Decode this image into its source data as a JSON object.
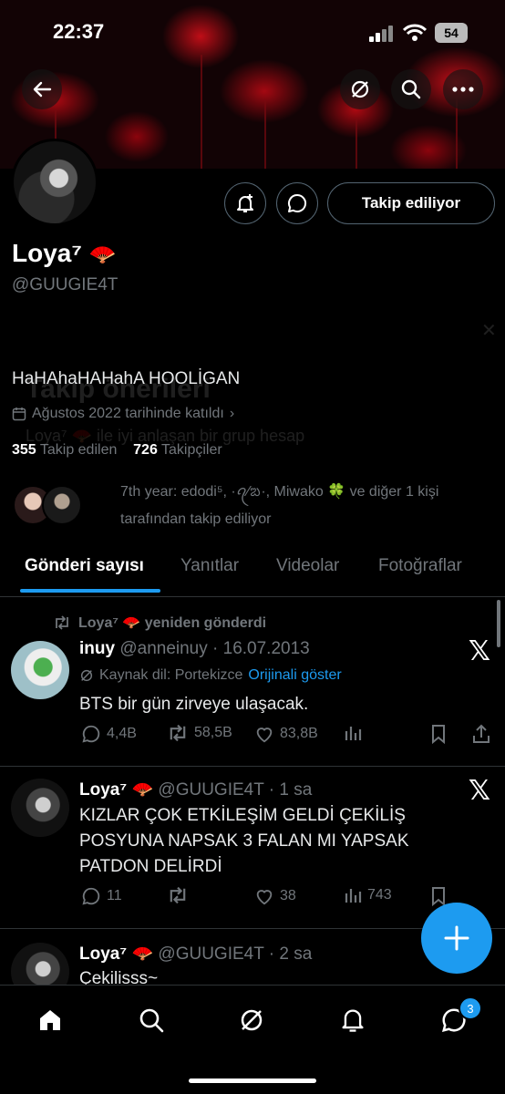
{
  "status_bar": {
    "time": "22:37",
    "battery": "54"
  },
  "profile": {
    "name": "Loya⁷",
    "handle": "@GUUGIE4T",
    "bio": "HaHAhaHAHahA HOOLİGAN",
    "joined": "Ağustos 2022 tarihinde katıldı",
    "following_count": "355",
    "following_label": "Takip edilen",
    "followers_count": "726",
    "followers_label": "Takipçiler",
    "follow_button": "Takip ediliyor",
    "followed_by": "7th year: edodi⁵, ·ꪖ⁄ᨰ·, Miwako 🍀 ve diğer 1 kişi tarafından takip ediliyor"
  },
  "ghost": {
    "title": "Takip önerileri",
    "subtitle": "Loya⁷ 🪭 ile iyi anlaşan bir grup hesap"
  },
  "tabs": [
    "Gönderi sayısı",
    "Yanıtlar",
    "Videolar",
    "Fotoğraflar"
  ],
  "posts": [
    {
      "repost_line": "Loya⁷ 🪭 yeniden gönderdi",
      "author": "inuy",
      "handle_date": "@anneinuy · 16.07.2013",
      "translate_source": "Kaynak dil: Portekizce",
      "translate_link": "Orijinali göster",
      "text": "BTS bir gün zirveye ulaşacak.",
      "replies": "4,4B",
      "reposts": "58,5B",
      "likes": "83,8B",
      "views": ""
    },
    {
      "author": "Loya⁷ 🪭",
      "handle_date": "@GUUGIE4T · 1 sa",
      "text": "KIZLAR ÇOK ETKİLEŞİM GELDİ ÇEKİLİŞ POSYUNA NAPSAK 3 FALAN MI YAPSAK PATDON DELİRDİ",
      "replies": "11",
      "reposts": "",
      "likes": "38",
      "views": "743"
    },
    {
      "author": "Loya⁷ 🪭",
      "handle_date": "@GUUGIE4T · 2 sa",
      "text": "Çekilisss~"
    }
  ],
  "nav": {
    "notifications_badge": "3"
  },
  "colors": {
    "accent": "#1d9bf0",
    "background": "#000000",
    "muted": "#71767b"
  }
}
